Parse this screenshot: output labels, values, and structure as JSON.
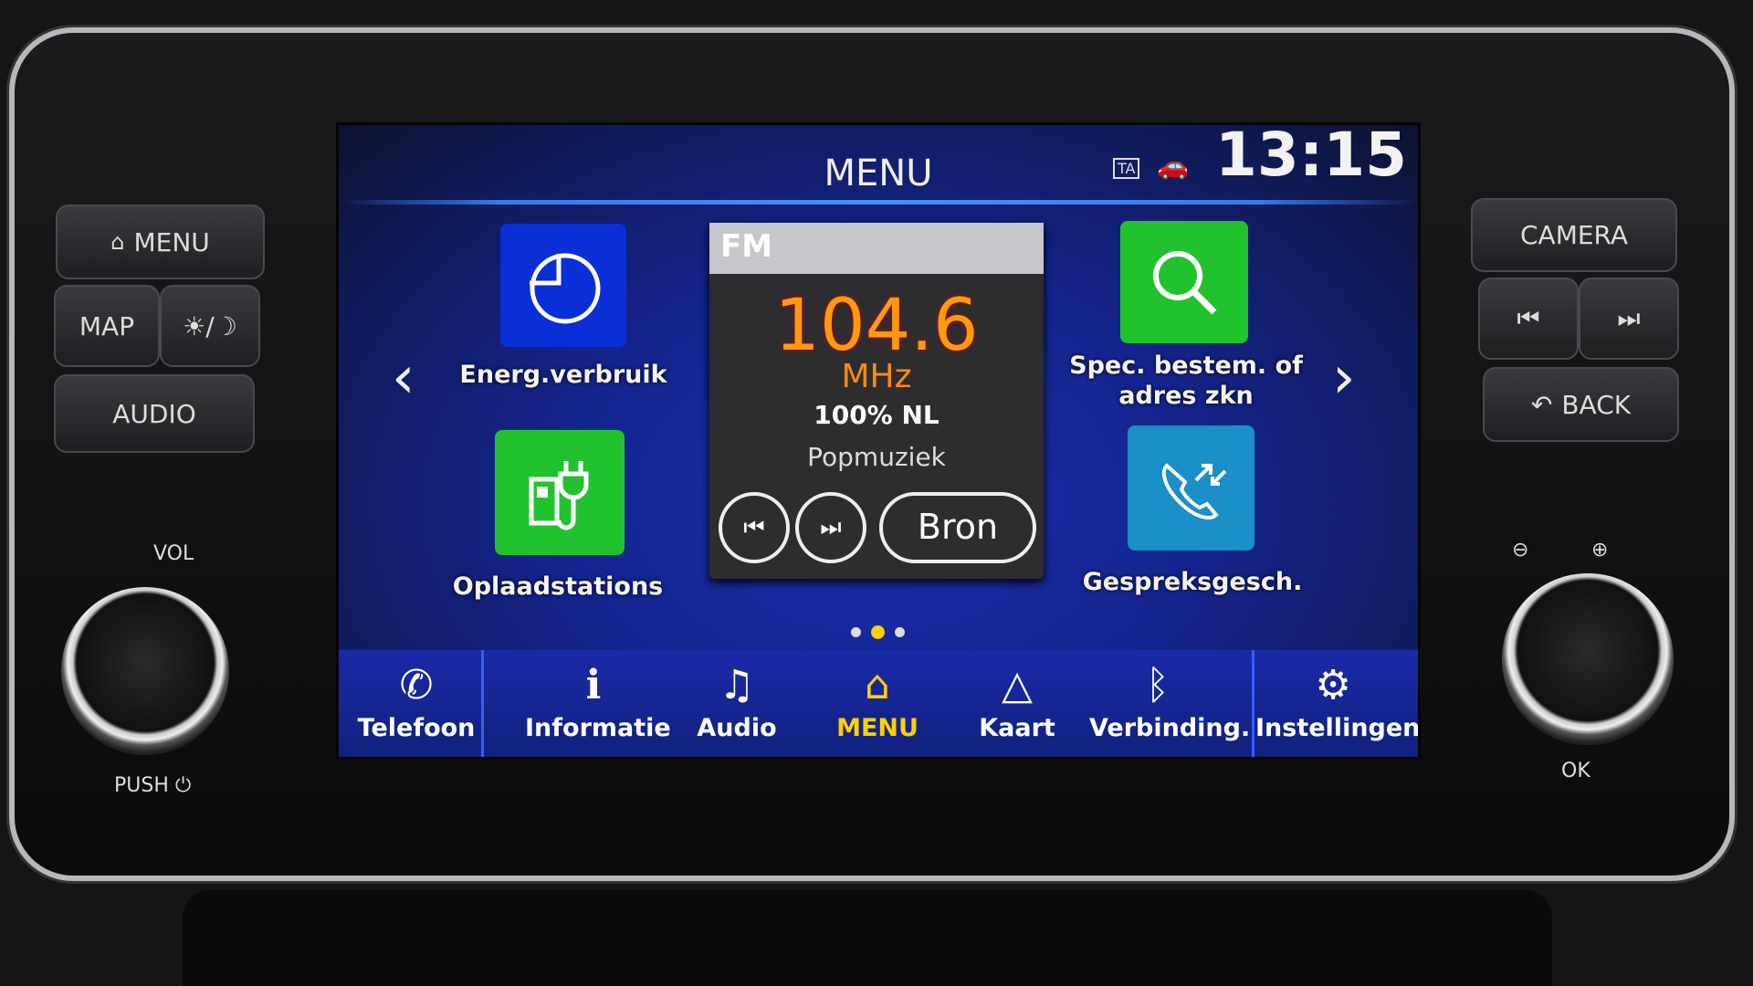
{
  "header": {
    "title": "MENU",
    "ta_badge": "TA",
    "car_icon": "ev-car-icon",
    "clock": "13:15"
  },
  "tiles": [
    {
      "label": "Energ.verbruik",
      "icon": "pie-chart-icon",
      "color": "#0a2fd6"
    },
    {
      "label": "Oplaadstations",
      "icon": "charging-station-icon",
      "color": "#22c22e"
    },
    {
      "label_line1": "Spec. bestem. of",
      "label_line2": "adres zkn",
      "icon": "search-icon",
      "color": "#22c22e"
    },
    {
      "label": "Gespreksgesch.",
      "icon": "call-history-icon",
      "color": "#1a8fc8"
    }
  ],
  "radio": {
    "band": "FM",
    "frequency": "104.6",
    "unit": "MHz",
    "station": "100% NL",
    "genre": "Popmuziek",
    "prev_icon": "⏮",
    "next_icon": "⏭",
    "source_label": "Bron"
  },
  "pager": {
    "pages": 3,
    "current": 2,
    "active_color": "#ffd000"
  },
  "bottom_bar": [
    {
      "label": "Telefoon",
      "icon": "phone-icon",
      "glyph": "✆"
    },
    {
      "label": "Informatie",
      "icon": "info-icon",
      "glyph": "i"
    },
    {
      "label": "Audio",
      "icon": "music-note-icon",
      "glyph": "♫"
    },
    {
      "label": "MENU",
      "icon": "home-icon",
      "glyph": "⌂",
      "active": true
    },
    {
      "label": "Kaart",
      "icon": "navigation-arrow-icon",
      "glyph": "△"
    },
    {
      "label": "Verbinding.",
      "icon": "bluetooth-wifi-icon",
      "glyph": "ᛒ"
    },
    {
      "label": "Instellingen",
      "icon": "gear-icon",
      "glyph": "⚙"
    }
  ],
  "hardware": {
    "menu": "MENU",
    "map": "MAP",
    "day_night": "☀/☽",
    "audio": "AUDIO",
    "camera": "CAMERA",
    "prev": "⏮",
    "next": "⏭",
    "back": "BACK",
    "vol": "VOL",
    "push": "PUSH",
    "power": "⏻",
    "ok": "OK",
    "zoom_out": "⊖",
    "zoom_in": "⊕"
  },
  "colors": {
    "accent": "#ffd000",
    "frequency": "#ff9a10"
  }
}
